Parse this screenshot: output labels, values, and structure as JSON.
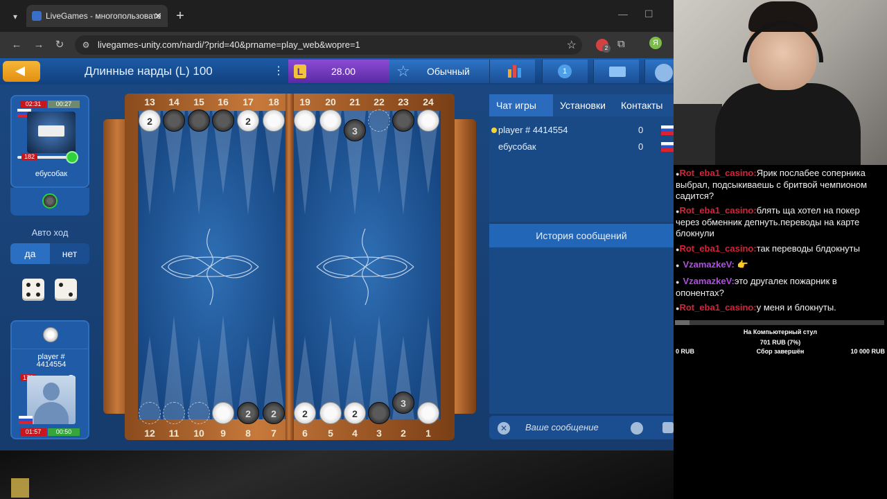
{
  "browser": {
    "tab_title": "LiveGames - многопользовате",
    "url": "livegames-unity.com/nardi/?prid=40&prname=play_web&wopre=1",
    "profile_initial": "Я",
    "ext_badge": "2"
  },
  "game": {
    "title": "Длинные нарды (L) 100",
    "balance": "28.00",
    "mode": "Обычный",
    "notif_count": "1"
  },
  "opponent": {
    "time_total": "02:31",
    "time_move": "00:27",
    "score": "182",
    "name": "ебусобак"
  },
  "me": {
    "name": "player # 4414554",
    "score": "176",
    "time_total": "01:57",
    "time_move": "00:50"
  },
  "auto_move": {
    "label": "Авто ход",
    "yes": "да",
    "no": "нет"
  },
  "dice": [
    4,
    2
  ],
  "board": {
    "top_points": [
      "13",
      "14",
      "15",
      "16",
      "17",
      "18",
      "19",
      "20",
      "21",
      "22",
      "23",
      "24"
    ],
    "bottom_points": [
      "12",
      "11",
      "10",
      "9",
      "8",
      "7",
      "6",
      "5",
      "4",
      "3",
      "2",
      "1"
    ],
    "top_checkers": [
      {
        "color": "w",
        "count": "2"
      },
      {
        "color": "b",
        "count": ""
      },
      {
        "color": "b",
        "count": ""
      },
      {
        "color": "b",
        "count": ""
      },
      {
        "color": "w",
        "count": "2"
      },
      {
        "color": "w",
        "count": ""
      },
      {
        "color": "w",
        "count": ""
      },
      {
        "color": "w",
        "count": ""
      },
      {
        "color": "b",
        "count": "3"
      },
      {
        "color": "g",
        "count": ""
      },
      {
        "color": "b",
        "count": ""
      },
      {
        "color": "w",
        "count": ""
      }
    ],
    "bottom_checkers": [
      {
        "color": "g",
        "count": ""
      },
      {
        "color": "g",
        "count": ""
      },
      {
        "color": "g",
        "count": ""
      },
      {
        "color": "w",
        "count": ""
      },
      {
        "color": "b",
        "count": "2"
      },
      {
        "color": "b",
        "count": "2"
      },
      {
        "color": "w",
        "count": "2"
      },
      {
        "color": "w",
        "count": ""
      },
      {
        "color": "w",
        "count": "2"
      },
      {
        "color": "b",
        "count": ""
      },
      {
        "color": "b",
        "count": "3"
      },
      {
        "color": "w",
        "count": ""
      }
    ]
  },
  "right_panel": {
    "tabs": [
      "Чат игры",
      "Установки",
      "Контакты"
    ],
    "players": [
      {
        "name": "player # 4414554",
        "score": "0"
      },
      {
        "name": "ебусобак",
        "score": "0"
      }
    ],
    "history_label": "История сообщений",
    "message_placeholder": "Ваше сообщение"
  },
  "stream_chat": [
    {
      "user": "Rot_eba1_casino:",
      "text": "Ярик послабее соперника выбрал, подсыкиваешь с бритвой чемпионом садится?",
      "kind": "u"
    },
    {
      "user": "Rot_eba1_casino:",
      "text": "блять ща хотел на покер через обменник депнуть.переводы на карте блокнули",
      "kind": "u"
    },
    {
      "user": "Rot_eba1_casino:",
      "text": "так переводы блдокнуты",
      "kind": "u"
    },
    {
      "user": "VzamazkeV:",
      "text": "👉",
      "kind": "u2"
    },
    {
      "user": "VzamazkeV:",
      "text": "это другалек пожарник в опонентах?",
      "kind": "u2"
    },
    {
      "user": "Rot_eba1_casino:",
      "text": "у меня и блокнуты.",
      "kind": "u"
    }
  ],
  "donation_goal": {
    "title": "На Компьютерный стул",
    "amount": "701 RUB (7%)",
    "progress": 0.07,
    "min": "0 RUB",
    "status": "Сбор завершён",
    "max": "10 000 RUB"
  }
}
